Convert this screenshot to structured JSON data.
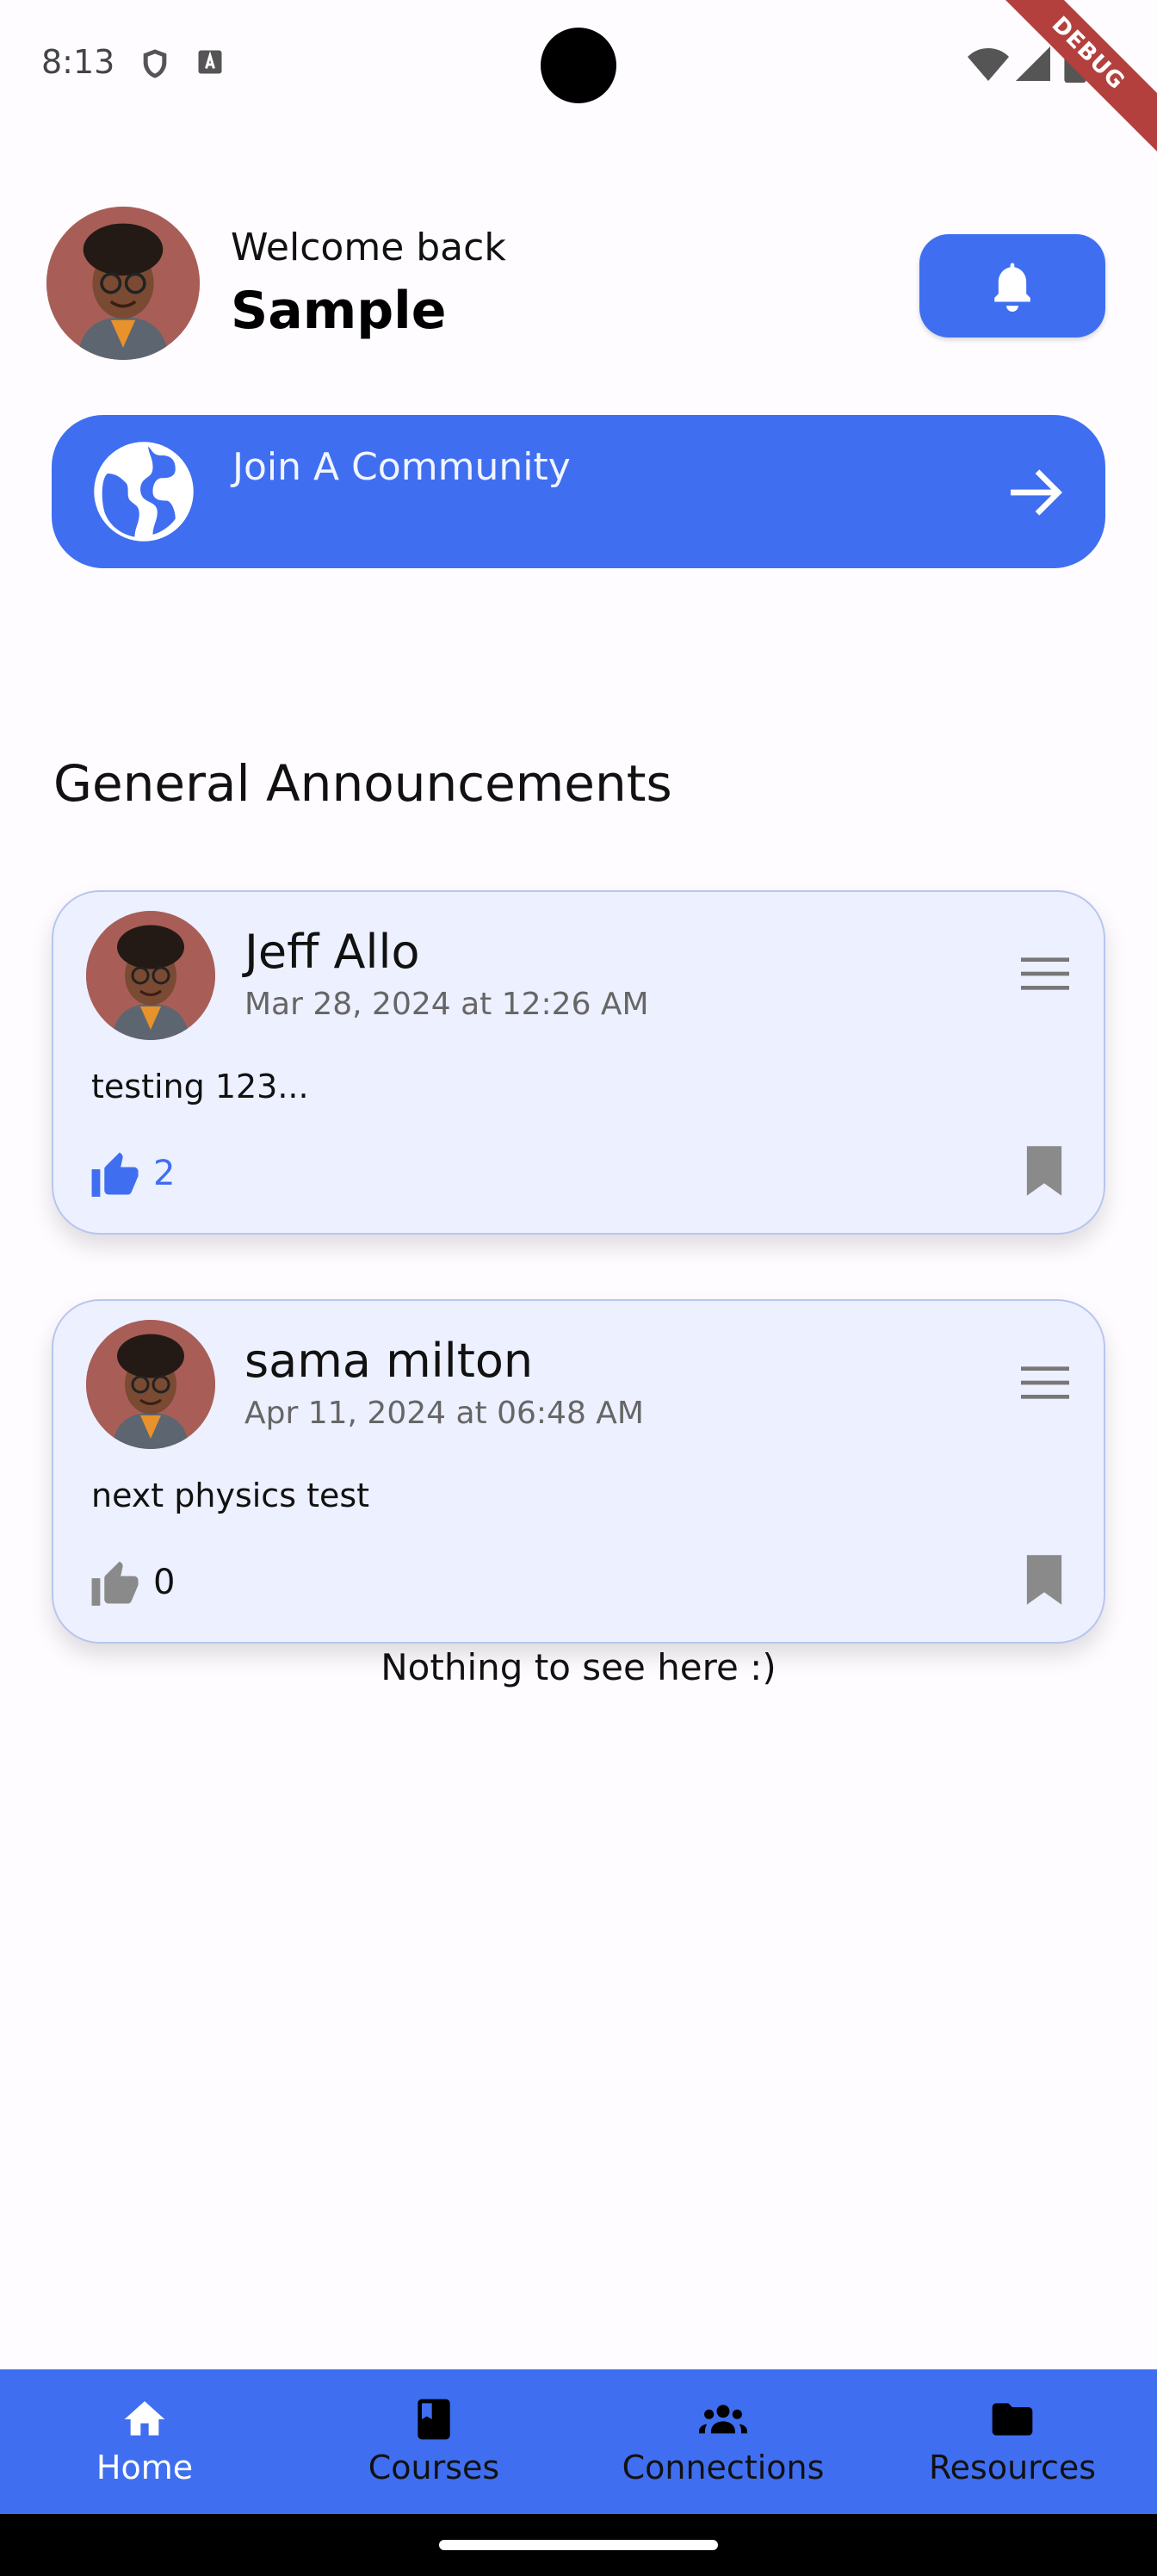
{
  "status_bar": {
    "time": "8:13",
    "debug_label": "DEBUG"
  },
  "header": {
    "greeting": "Welcome back",
    "username": "Sample",
    "notification_icon": "bell-icon"
  },
  "join_community": {
    "label": "Join A Community",
    "icon": "globe-icon",
    "arrow_icon": "arrow-right-icon"
  },
  "announcements": {
    "title": "General Announcements",
    "posts": [
      {
        "author": "Jeff Allo",
        "date": "Mar 28, 2024 at 12:26 AM",
        "body": "testing 123...",
        "likes": "2",
        "liked": true
      },
      {
        "author": "sama milton",
        "date": "Apr 11, 2024 at 06:48 AM",
        "body": "next physics test",
        "likes": "0",
        "liked": false
      }
    ],
    "empty_note": "Nothing to see here :)"
  },
  "bottom_nav": {
    "items": [
      {
        "label": "Home",
        "icon": "home-icon",
        "active": true
      },
      {
        "label": "Courses",
        "icon": "book-icon",
        "active": false
      },
      {
        "label": "Connections",
        "icon": "people-icon",
        "active": false
      },
      {
        "label": "Resources",
        "icon": "folder-icon",
        "active": false
      }
    ]
  },
  "colors": {
    "primary": "#3f6ff0",
    "card_background": "#edf0fe",
    "liked": "#3f6ff0",
    "unliked": "#8a8a8a"
  }
}
